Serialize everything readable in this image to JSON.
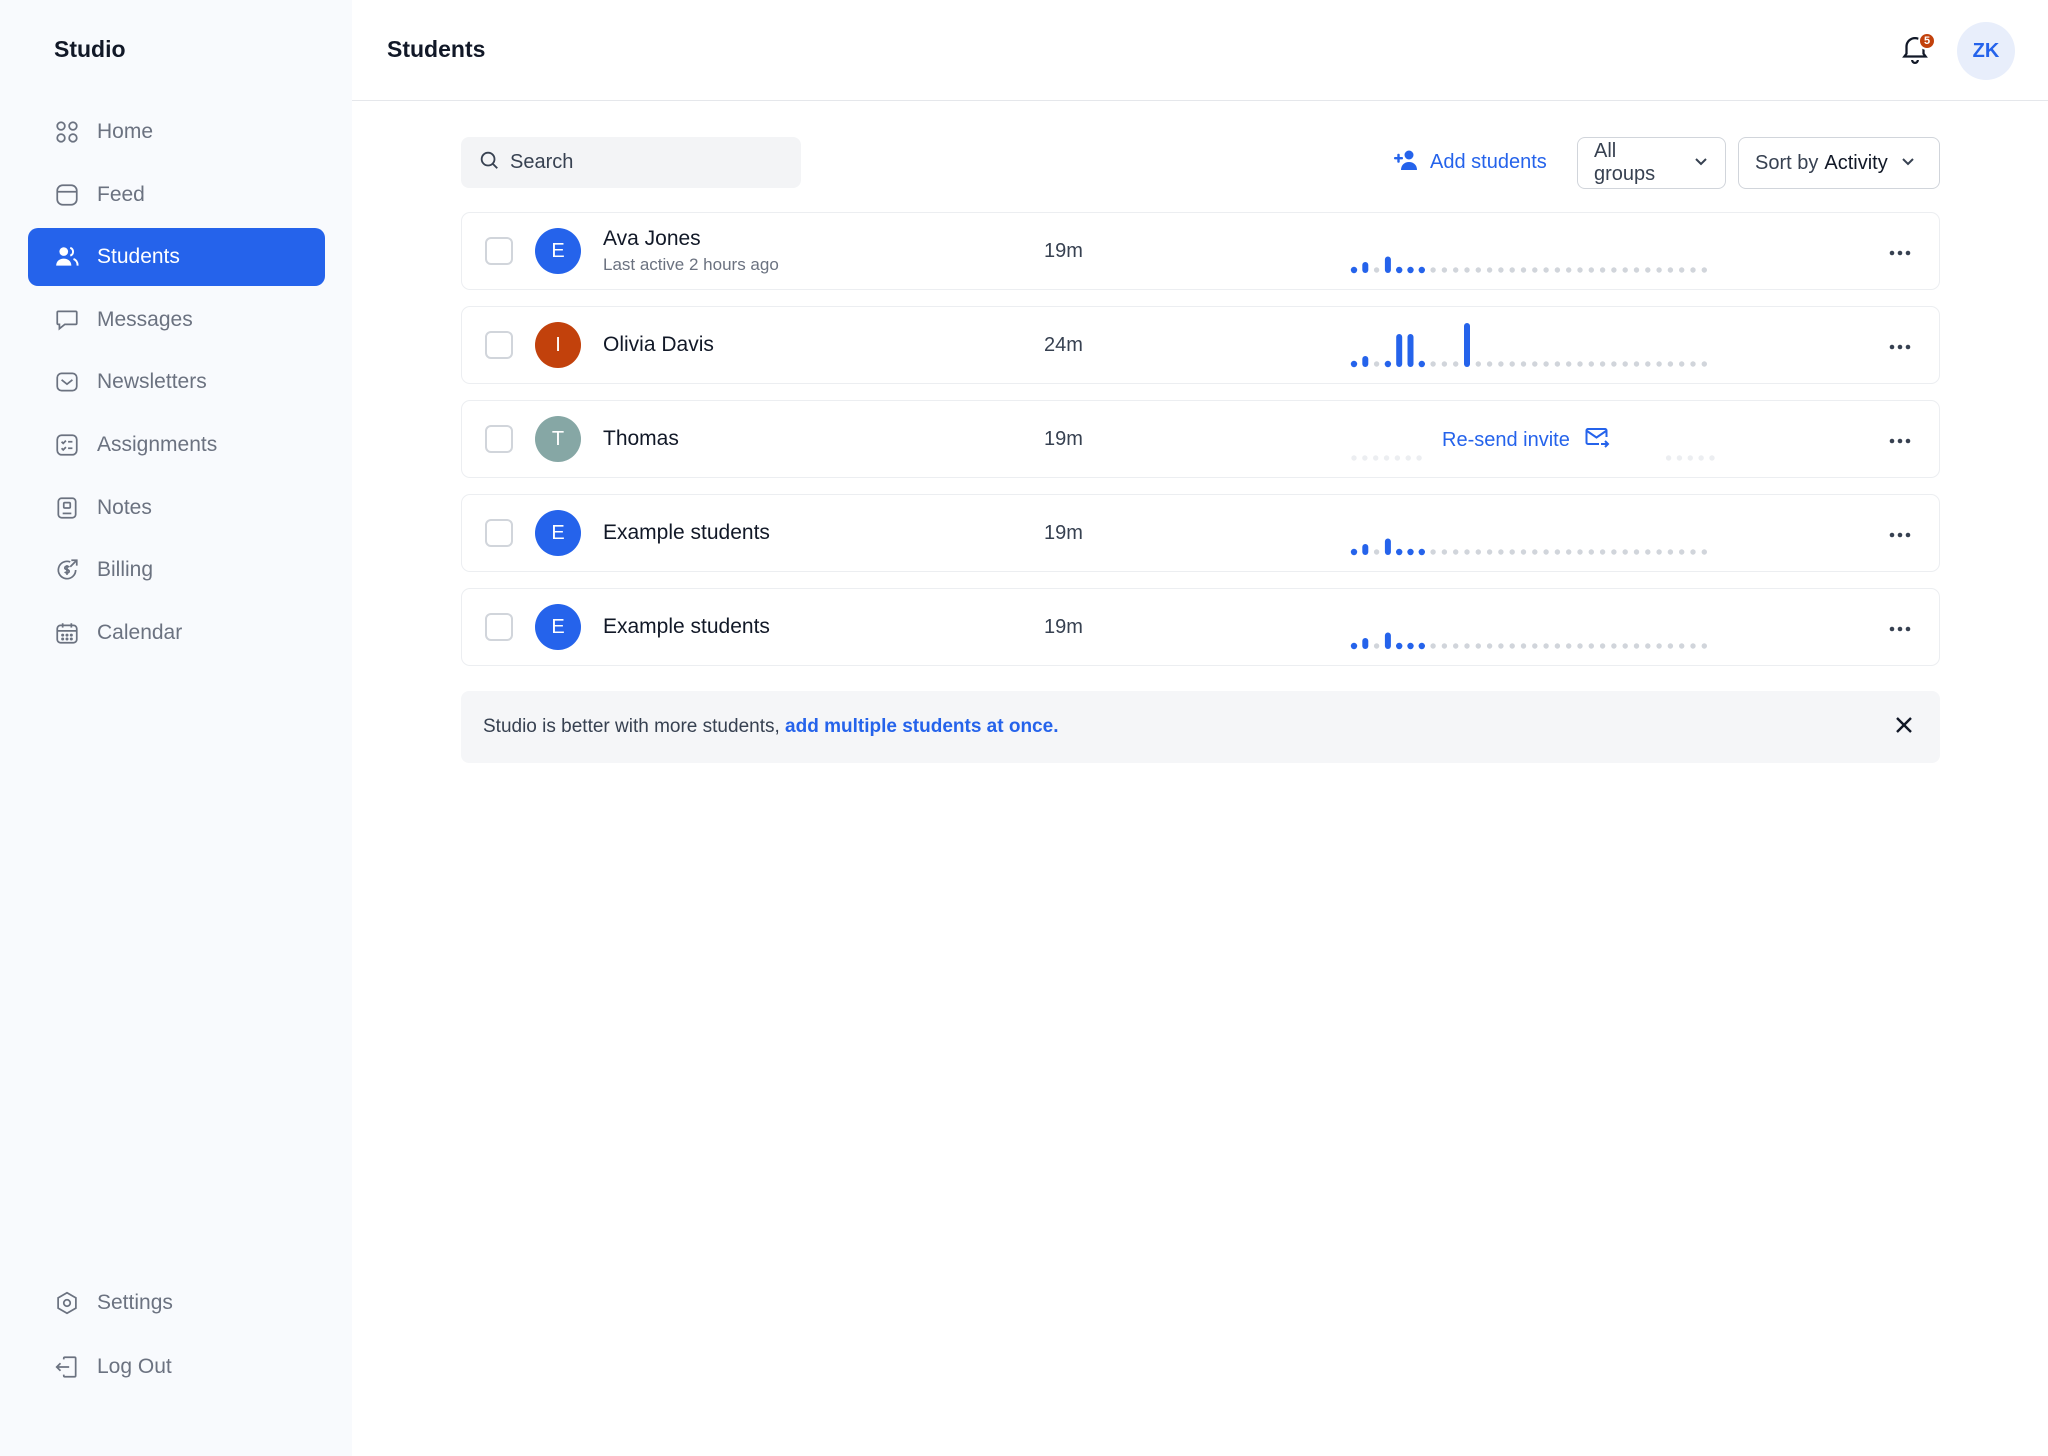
{
  "app": {
    "name": "Studio"
  },
  "sidebar": {
    "items": [
      {
        "label": "Home",
        "icon": "grid-icon"
      },
      {
        "label": "Feed",
        "icon": "feed-icon"
      },
      {
        "label": "Students",
        "icon": "users-icon",
        "active": true
      },
      {
        "label": "Messages",
        "icon": "message-icon"
      },
      {
        "label": "Newsletters",
        "icon": "mail-icon"
      },
      {
        "label": "Assignments",
        "icon": "checklist-icon"
      },
      {
        "label": "Notes",
        "icon": "notebook-icon"
      },
      {
        "label": "Billing",
        "icon": "billing-icon"
      },
      {
        "label": "Calendar",
        "icon": "calendar-icon"
      }
    ],
    "bottom": [
      {
        "label": "Settings",
        "icon": "gear-icon"
      },
      {
        "label": "Log Out",
        "icon": "logout-icon"
      }
    ]
  },
  "header": {
    "title": "Students",
    "notifications_count": "5",
    "user_initials": "ZK"
  },
  "toolbar": {
    "search_placeholder": "Search",
    "add_students_label": "Add students",
    "groups_filter": "All groups",
    "sort_prefix": "Sort by",
    "sort_value": "Activity"
  },
  "students": [
    {
      "initial": "E",
      "name": "Ava Jones",
      "subtitle": "Last active 2 hours ago",
      "time": "19m",
      "avatar_color": "#2563eb",
      "activity": [
        1,
        2,
        0,
        3,
        1,
        1,
        1,
        0,
        0,
        0,
        0,
        0,
        0,
        0,
        0,
        0,
        0,
        0,
        0,
        0,
        0,
        0,
        0,
        0,
        0,
        0,
        0,
        0,
        0,
        0,
        0,
        0
      ]
    },
    {
      "initial": "I",
      "name": "Olivia Davis",
      "subtitle": "",
      "time": "24m",
      "avatar_color": "#c2410c",
      "activity": [
        1,
        2,
        0,
        1,
        6,
        6,
        1,
        0,
        0,
        0,
        8,
        0,
        0,
        0,
        0,
        0,
        0,
        0,
        0,
        0,
        0,
        0,
        0,
        0,
        0,
        0,
        0,
        0,
        0,
        0,
        0,
        0
      ]
    },
    {
      "initial": "T",
      "name": "Thomas",
      "subtitle": "",
      "time": "19m",
      "avatar_color": "#86a7a5",
      "invite_pending": true,
      "resend_label": "Re-send invite"
    },
    {
      "initial": "E",
      "name": "Example students",
      "subtitle": "",
      "time": "19m",
      "avatar_color": "#2563eb",
      "activity": [
        1,
        2,
        0,
        3,
        1,
        1,
        1,
        0,
        0,
        0,
        0,
        0,
        0,
        0,
        0,
        0,
        0,
        0,
        0,
        0,
        0,
        0,
        0,
        0,
        0,
        0,
        0,
        0,
        0,
        0,
        0,
        0
      ]
    },
    {
      "initial": "E",
      "name": "Example students",
      "subtitle": "",
      "time": "19m",
      "avatar_color": "#2563eb",
      "activity": [
        1,
        2,
        0,
        3,
        1,
        1,
        1,
        0,
        0,
        0,
        0,
        0,
        0,
        0,
        0,
        0,
        0,
        0,
        0,
        0,
        0,
        0,
        0,
        0,
        0,
        0,
        0,
        0,
        0,
        0,
        0,
        0
      ]
    }
  ],
  "banner": {
    "text": "Studio is better with more students, ",
    "link": "add multiple students at once."
  },
  "colors": {
    "accent": "#2563eb",
    "badge": "#c2410c",
    "inactive_dot": "#d1d5db"
  }
}
